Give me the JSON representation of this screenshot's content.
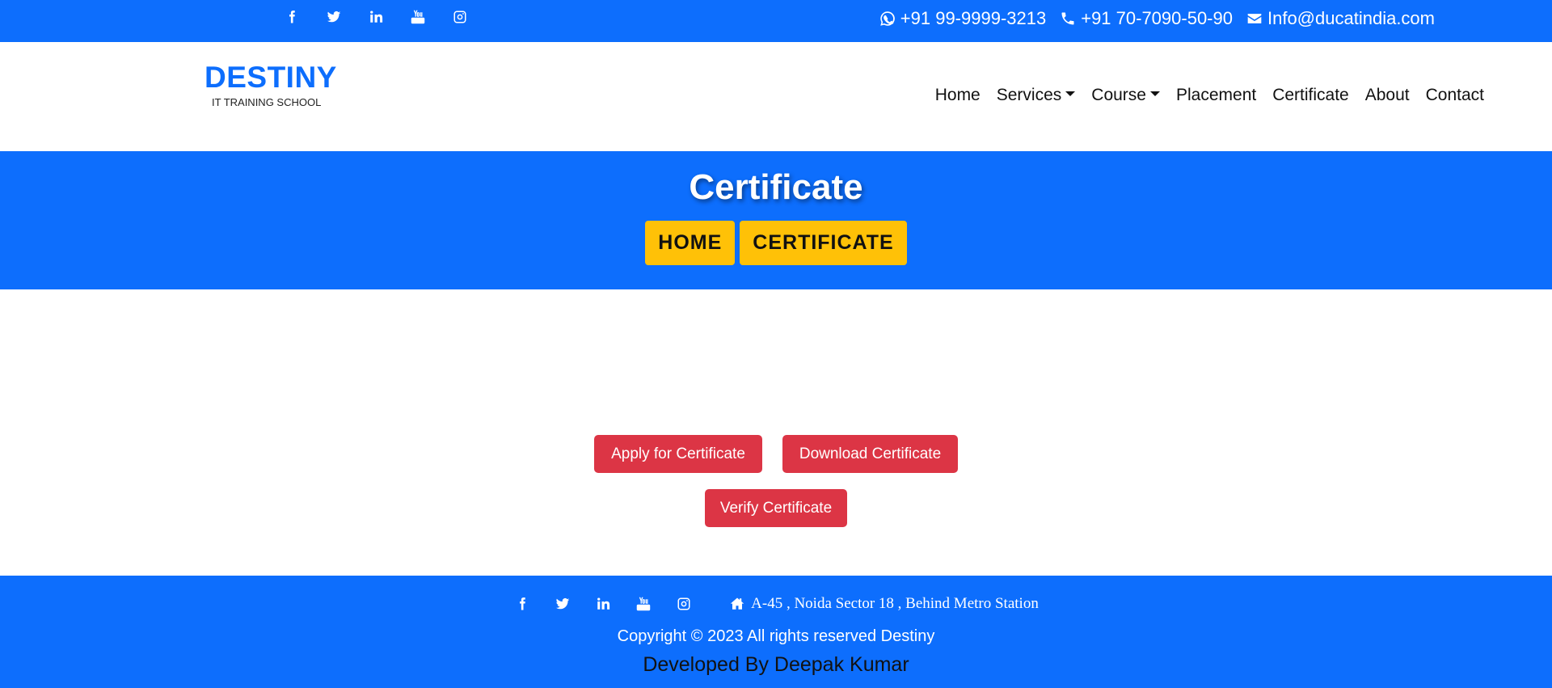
{
  "topbar": {
    "social_icons": [
      "facebook-icon",
      "twitter-icon",
      "linkedin-icon",
      "youtube-icon",
      "instagram-icon"
    ],
    "phone1": "+91 99-9999-3213",
    "phone2": "+91 70-7090-50-90",
    "email": "Info@ducatindia.com"
  },
  "brand": {
    "name": "DESTINY",
    "tagline": "IT TRAINING SCHOOL"
  },
  "nav": {
    "home": "Home",
    "services": "Services",
    "course": "Course",
    "placement": "Placement",
    "certificate": "Certificate",
    "about": "About",
    "contact": "Contact"
  },
  "hero": {
    "title": "Certificate",
    "crumb_home": "HOME",
    "crumb_current": "CERTIFICATE"
  },
  "actions": {
    "apply": "Apply for Certificate",
    "download": "Download Certificate",
    "verify": "Verify Certificate"
  },
  "footer": {
    "address": "A-45 , Noida Sector 18 , Behind Metro Station",
    "copyright": "Copyright © 2023 All rights reserved Destiny",
    "developer": "Developed By Deepak Kumar"
  },
  "colors": {
    "primary": "#0d6efd",
    "accent": "#ffc107",
    "danger": "#dc3545"
  }
}
